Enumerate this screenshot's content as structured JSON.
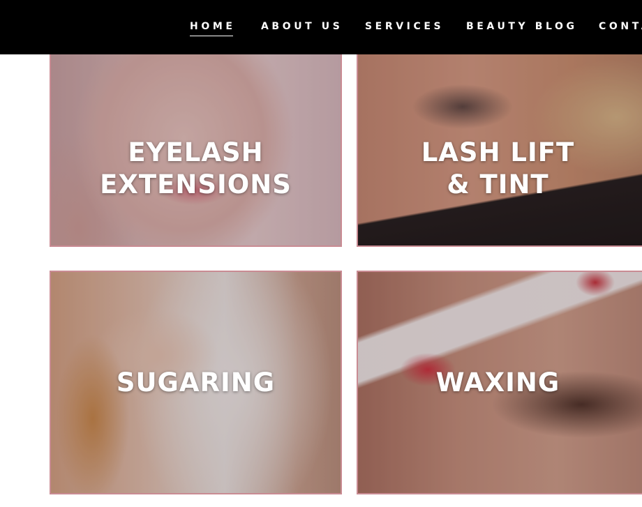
{
  "nav": {
    "items": [
      {
        "label": "HOME",
        "active": true
      },
      {
        "label": "ABOUT US",
        "active": false
      },
      {
        "label": "SERVICES",
        "active": false
      },
      {
        "label": "BEAUTY BLOG",
        "active": false
      },
      {
        "label": "CONTA",
        "active": false
      }
    ]
  },
  "services": [
    {
      "title_line1": "EYELASH",
      "title_line2": "EXTENSIONS",
      "photo": "woman-smiling-eyelash-photo"
    },
    {
      "title_line1": "LASH LIFT",
      "title_line2": "& TINT",
      "photo": "eye-closeup-lashes-photo"
    },
    {
      "title_line1": "SUGARING",
      "title_line2": "",
      "photo": "sugaring-arm-photo"
    },
    {
      "title_line1": "WAXING",
      "title_line2": "",
      "photo": "eyebrow-wax-strip-photo"
    }
  ],
  "colors": {
    "nav_background": "#000000",
    "nav_text": "#ffffff",
    "tile_border": "#c98b93",
    "tile_text": "#ffffff"
  }
}
